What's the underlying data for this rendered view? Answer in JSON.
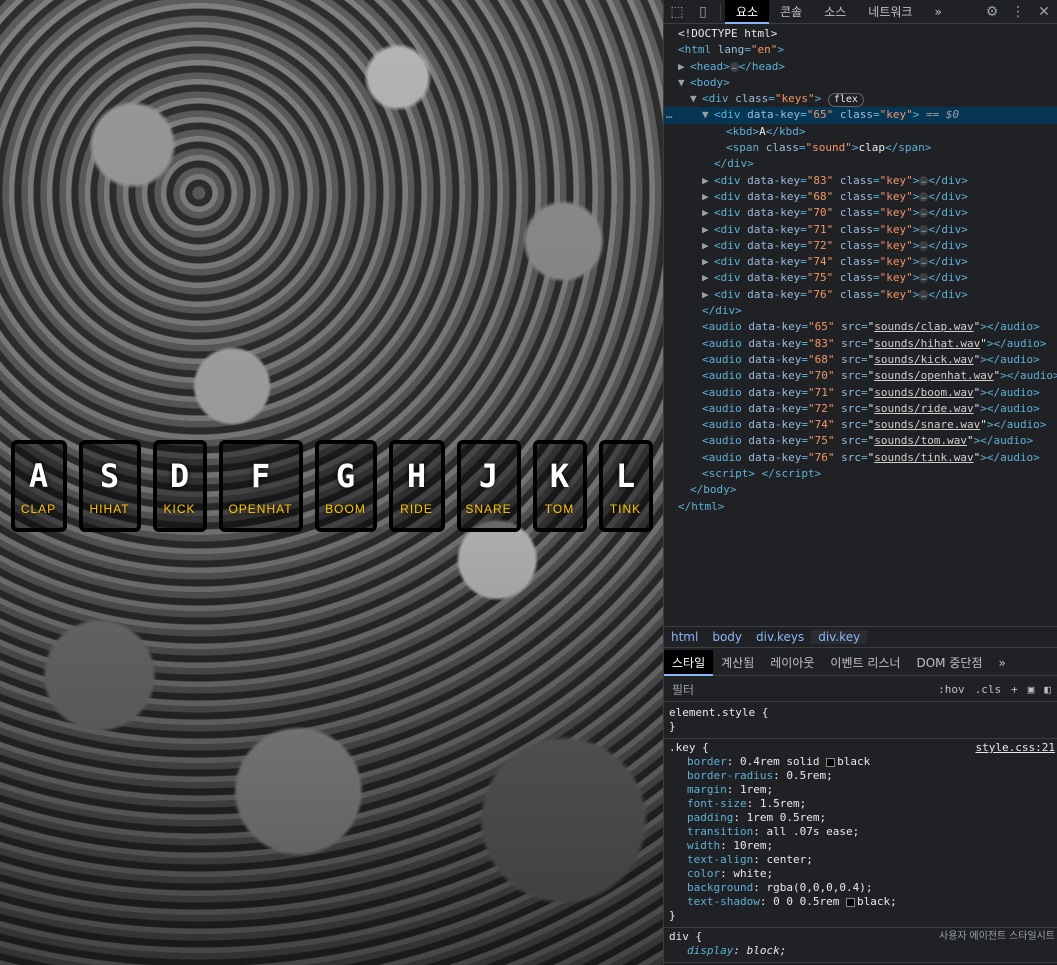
{
  "keys": [
    {
      "letter": "A",
      "sound": "CLAP"
    },
    {
      "letter": "S",
      "sound": "HIHAT"
    },
    {
      "letter": "D",
      "sound": "KICK"
    },
    {
      "letter": "F",
      "sound": "OPENHAT"
    },
    {
      "letter": "G",
      "sound": "BOOM"
    },
    {
      "letter": "H",
      "sound": "RIDE"
    },
    {
      "letter": "J",
      "sound": "SNARE"
    },
    {
      "letter": "K",
      "sound": "TOM"
    },
    {
      "letter": "L",
      "sound": "TINK"
    }
  ],
  "devtools": {
    "tabs": [
      "요소",
      "콘솔",
      "소스",
      "네트워크"
    ],
    "more_tabs": "»",
    "dom": {
      "doctype": "<!DOCTYPE html>",
      "html_lang": "en",
      "keys_class": "keys",
      "flex_badge": "flex",
      "selected_marker": "== $0",
      "first_key_code": "65",
      "first_kbd": "A",
      "first_span_class": "sound",
      "first_span_text": "clap",
      "key_class": "key",
      "other_key_codes": [
        "83",
        "68",
        "70",
        "71",
        "72",
        "74",
        "75",
        "76"
      ],
      "audios": [
        {
          "key": "65",
          "src": "sounds/clap.wav"
        },
        {
          "key": "83",
          "src": "sounds/hihat.wav"
        },
        {
          "key": "68",
          "src": "sounds/kick.wav"
        },
        {
          "key": "70",
          "src": "sounds/openhat.wav"
        },
        {
          "key": "71",
          "src": "sounds/boom.wav"
        },
        {
          "key": "72",
          "src": "sounds/ride.wav"
        },
        {
          "key": "74",
          "src": "sounds/snare.wav"
        },
        {
          "key": "75",
          "src": "sounds/tom.wav"
        },
        {
          "key": "76",
          "src": "sounds/tink.wav"
        }
      ]
    },
    "breadcrumbs": [
      "html",
      "body",
      "div.keys",
      "div.key"
    ],
    "style_tabs": [
      "스타일",
      "계산됨",
      "레이아웃",
      "이벤트 리스너",
      "DOM 중단점"
    ],
    "filter_placeholder": "필터",
    "filter_hov": ":hov",
    "filter_cls": ".cls",
    "element_style": "element.style {",
    "key_rule": {
      "selector": ".key {",
      "source": "style.css:21",
      "props": [
        {
          "name": "border",
          "value": "0.4rem solid",
          "color": "black",
          "swatch": "#000000"
        },
        {
          "name": "border-radius",
          "value": "0.5rem;"
        },
        {
          "name": "margin",
          "value": "1rem;"
        },
        {
          "name": "font-size",
          "value": "1.5rem;"
        },
        {
          "name": "padding",
          "value": "1rem 0.5rem;"
        },
        {
          "name": "transition",
          "value": "all .07s",
          "color": "ease;"
        },
        {
          "name": "width",
          "value": "10rem;"
        },
        {
          "name": "text-align",
          "value": "center;"
        },
        {
          "name": "color",
          "value": "white;",
          "swatch": "#ffffff"
        },
        {
          "name": "background",
          "value": "rgba(0,0,0,0.4);"
        },
        {
          "name": "text-shadow",
          "value": "0 0 0.5rem",
          "color": "black;",
          "swatch": "#000000"
        }
      ]
    },
    "div_rule": {
      "selector": "div {",
      "source": "사용자 에이전트 스타일시트",
      "prop_name": "display",
      "prop_value": "block;"
    }
  },
  "colors": {
    "sound_label": "#ffc600",
    "selected_row": "#073655",
    "accent": "#8ab4f8"
  }
}
